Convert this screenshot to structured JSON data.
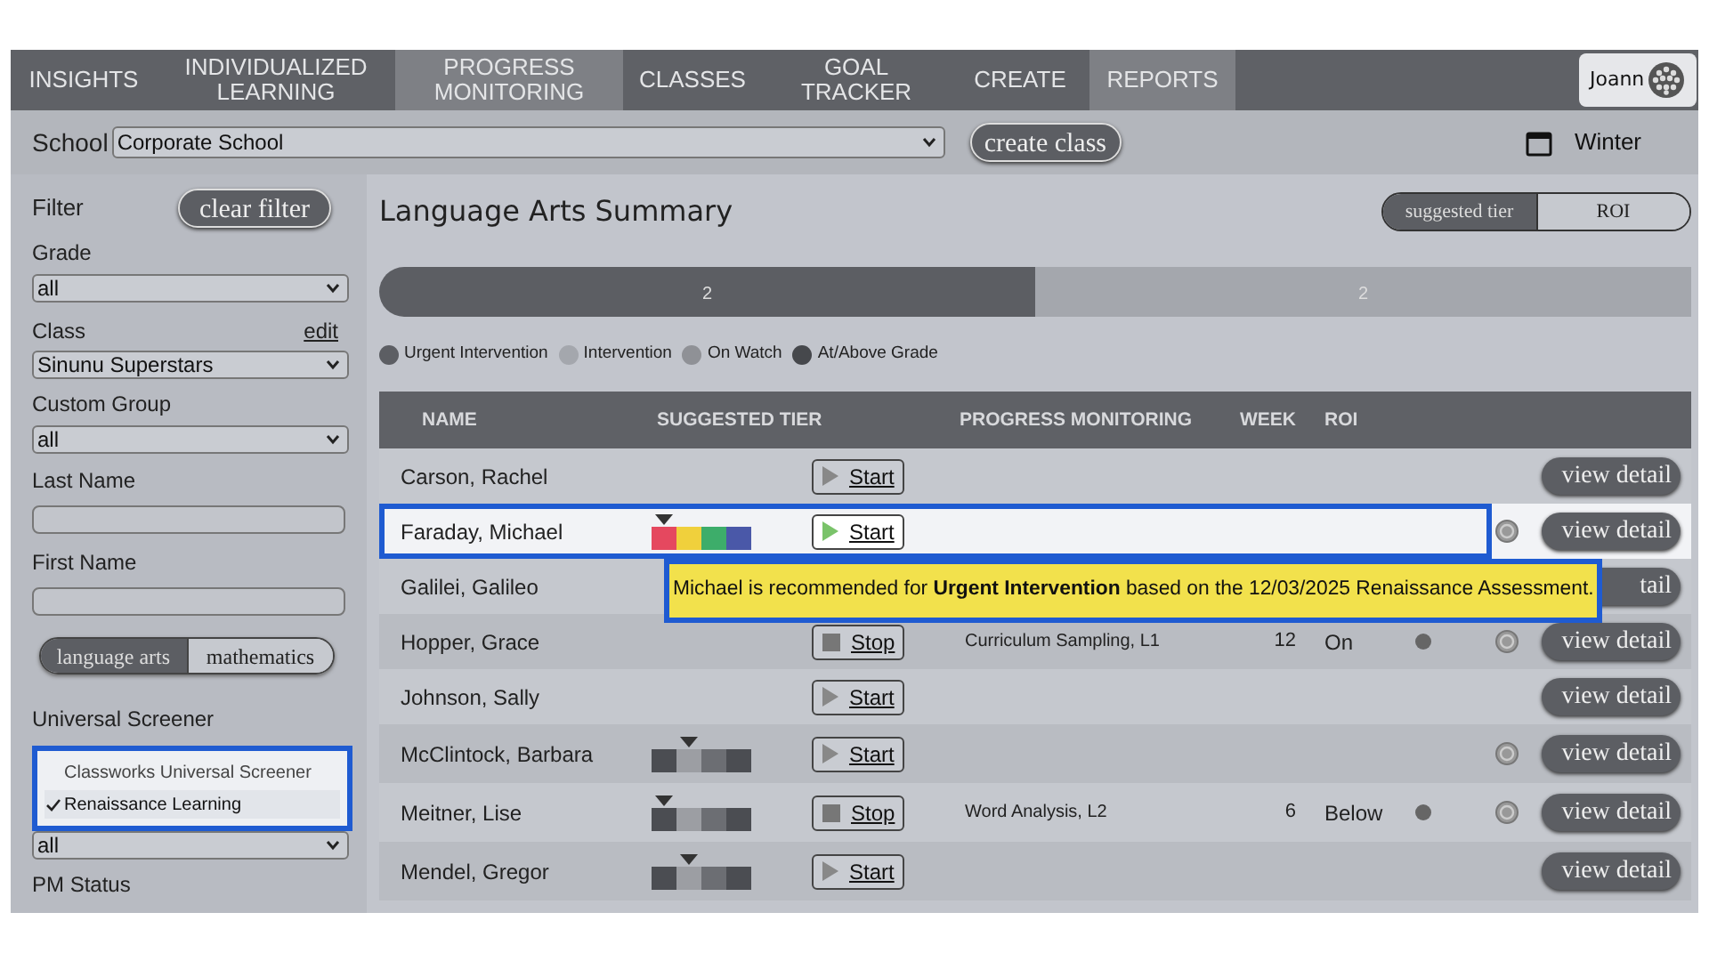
{
  "nav": {
    "tabs": [
      {
        "label": "INSIGHTS",
        "selected": false
      },
      {
        "label": "INDIVIDUALIZED LEARNING",
        "selected": false
      },
      {
        "label": "PROGRESS MONITORING",
        "selected": true
      },
      {
        "label": "CLASSES",
        "selected": false
      },
      {
        "label": "GOAL TRACKER",
        "selected": false
      },
      {
        "label": "CREATE",
        "selected": false
      },
      {
        "label": "REPORTS",
        "selected": true
      }
    ],
    "user": "Joann"
  },
  "school_bar": {
    "label": "School",
    "value": "Corporate School",
    "button": "create class",
    "season": "Winter"
  },
  "sidebar": {
    "title": "Filter",
    "clear_button": "clear filter",
    "grade": {
      "label": "Grade",
      "value": "all"
    },
    "class": {
      "label": "Class",
      "edit": "edit",
      "value": "Sinunu Superstars"
    },
    "custom_group": {
      "label": "Custom Group",
      "value": "all"
    },
    "last_name": {
      "label": "Last Name"
    },
    "first_name": {
      "label": "First Name"
    },
    "subjects": [
      {
        "label": "language arts",
        "selected": true
      },
      {
        "label": "mathematics",
        "selected": false
      }
    ],
    "screener": {
      "label": "Universal Screener",
      "options": [
        {
          "label": "Classworks Universal Screener",
          "selected": false
        },
        {
          "label": "Renaissance Learning",
          "selected": true
        }
      ]
    },
    "pm_select": {
      "value": "all"
    },
    "pm_status": {
      "label": "PM Status"
    }
  },
  "summary": {
    "title": "Language Arts Summary",
    "view_toggle": [
      {
        "label": "suggested tier",
        "selected": true
      },
      {
        "label": "ROI",
        "selected": false
      }
    ],
    "chart_data": {
      "type": "bar",
      "orientation": "horizontal",
      "stacked": true,
      "legend": "bottom",
      "data_labels": true,
      "series": [
        {
          "name": "Urgent Intervention",
          "color": "#5c5e63",
          "values": [
            2
          ]
        },
        {
          "name": "Intervention",
          "color": "#a4a7ad",
          "values": [
            2
          ]
        },
        {
          "name": "On Watch",
          "color": "#8f9196",
          "values": [
            null
          ]
        },
        {
          "name": "At/Above Grade",
          "color": "#46484c",
          "values": [
            null
          ]
        }
      ]
    }
  },
  "table": {
    "columns": [
      "NAME",
      "SUGGESTED TIER",
      "PROGRESS MONITORING",
      "WEEK",
      "ROI"
    ],
    "rows": [
      {
        "name": "Carson, Rachel",
        "selected": false,
        "button": {
          "kind": "start",
          "label": "Start"
        },
        "badge": false,
        "roi_dot": false,
        "detail": "view detail"
      },
      {
        "name": "Faraday, Michael",
        "selected": true,
        "tier": [
          {
            "color": "#e5485f",
            "selected": true
          },
          {
            "color": "#f0d03c",
            "selected": false
          },
          {
            "color": "#3dad6a",
            "selected": false
          },
          {
            "color": "#4a58a8",
            "selected": false
          }
        ],
        "button": {
          "kind": "start",
          "label": "Start"
        },
        "badge": true,
        "roi_dot": false,
        "detail": "view detail"
      },
      {
        "name": "Galilei, Galileo",
        "selected": false,
        "badge": false,
        "roi_dot": false,
        "detail": "tail"
      },
      {
        "name": "Hopper, Grace",
        "selected": false,
        "button": {
          "kind": "stop",
          "label": "Stop"
        },
        "pm": "Curriculum Sampling, L1",
        "week": "12",
        "roi": "On",
        "roi_dot": true,
        "badge": true,
        "detail": "view detail"
      },
      {
        "name": "Johnson, Sally",
        "selected": false,
        "button": {
          "kind": "start",
          "label": "Start"
        },
        "badge": false,
        "roi_dot": false,
        "detail": "view detail"
      },
      {
        "name": "McClintock, Barbara",
        "selected": false,
        "tier": [
          {
            "color": "#4b4d52",
            "selected": false
          },
          {
            "color": "#9c9ea3",
            "selected": true
          },
          {
            "color": "#6c6e73",
            "selected": false
          },
          {
            "color": "#4b4d52",
            "selected": false
          }
        ],
        "button": {
          "kind": "start",
          "label": "Start"
        },
        "badge": true,
        "roi_dot": false,
        "detail": "view detail"
      },
      {
        "name": "Meitner, Lise",
        "selected": false,
        "tier": [
          {
            "color": "#4b4d52",
            "selected": true
          },
          {
            "color": "#9c9ea3",
            "selected": false
          },
          {
            "color": "#6c6e73",
            "selected": false
          },
          {
            "color": "#4b4d52",
            "selected": false
          }
        ],
        "button": {
          "kind": "stop",
          "label": "Stop"
        },
        "pm": "Word Analysis, L2",
        "week": "6",
        "roi": "Below",
        "roi_dot": true,
        "badge": true,
        "detail": "view detail"
      },
      {
        "name": "Mendel, Gregor",
        "selected": false,
        "tier": [
          {
            "color": "#4b4d52",
            "selected": false
          },
          {
            "color": "#9c9ea3",
            "selected": true
          },
          {
            "color": "#6c6e73",
            "selected": false
          },
          {
            "color": "#4b4d52",
            "selected": false
          }
        ],
        "button": {
          "kind": "start",
          "label": "Start"
        },
        "badge": false,
        "roi_dot": false,
        "detail": "view detail"
      }
    ]
  },
  "tooltip": "Michael is recommended for **Urgent Intervention** based on the 12/03/2025 Renaissance Assessment."
}
